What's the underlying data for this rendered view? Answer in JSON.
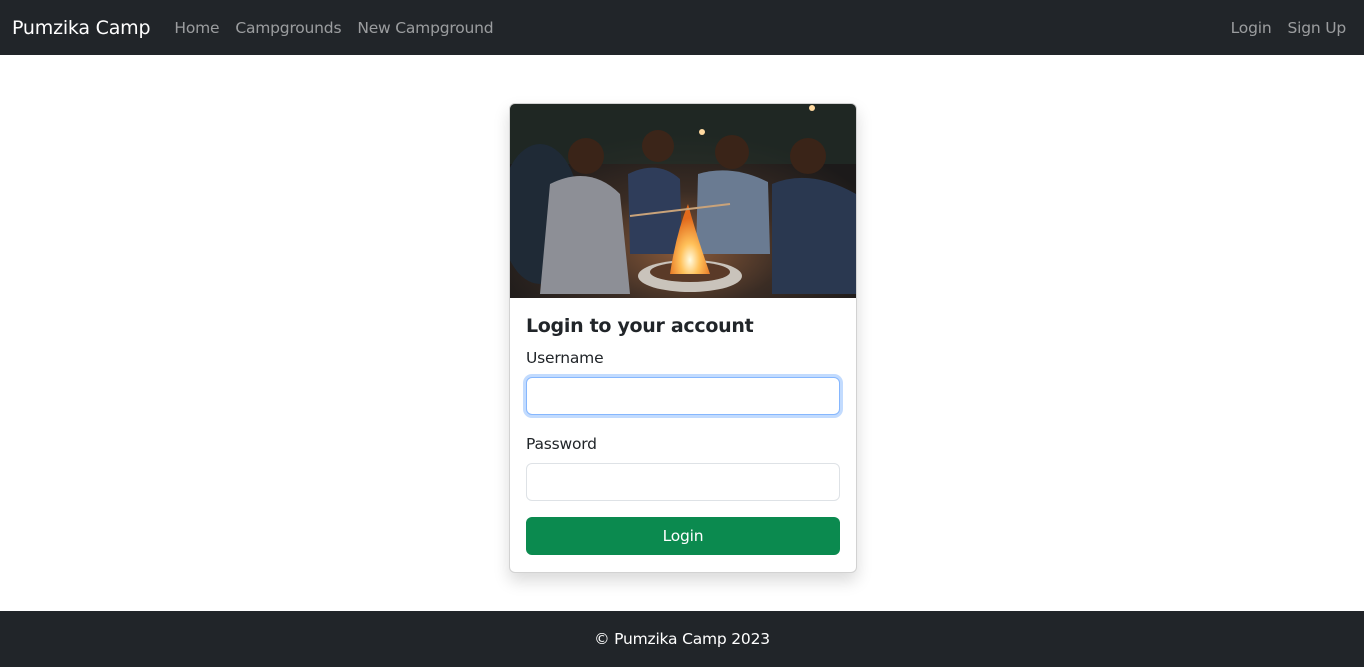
{
  "navbar": {
    "brand": "Pumzika Camp",
    "links": [
      "Home",
      "Campgrounds",
      "New Campground"
    ],
    "auth_links": [
      "Login",
      "Sign Up"
    ]
  },
  "card": {
    "image_icon": "campfire-photo",
    "title": "Login to your account",
    "username_label": "Username",
    "username_value": "",
    "password_label": "Password",
    "password_value": "",
    "submit_label": "Login"
  },
  "footer": {
    "text": "© Pumzika Camp 2023"
  },
  "colors": {
    "navbar_bg": "#212529",
    "button_bg": "#198754",
    "focus_border": "#86b7fe"
  }
}
